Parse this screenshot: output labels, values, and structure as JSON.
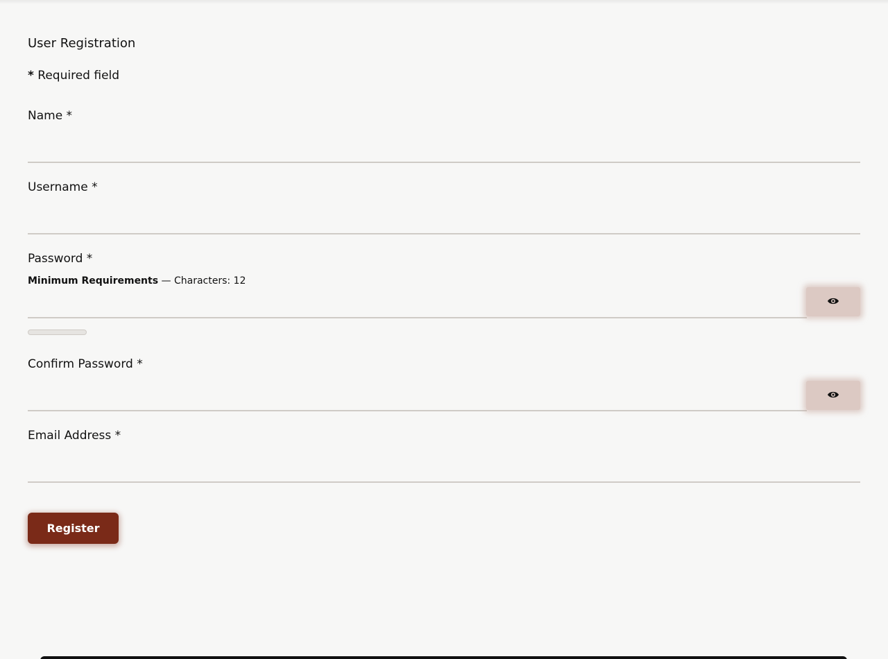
{
  "form": {
    "title": "User Registration",
    "required_star": "*",
    "required_text": "Required field",
    "fields": {
      "name": {
        "label": "Name *",
        "value": ""
      },
      "username": {
        "label": "Username *",
        "value": ""
      },
      "password": {
        "label": "Password *",
        "hint_bold": "Minimum Requirements",
        "hint_text": " — Characters: 12",
        "value": "",
        "strength": 0
      },
      "confirm_password": {
        "label": "Confirm Password *",
        "value": ""
      },
      "email": {
        "label": "Email Address *",
        "value": ""
      }
    },
    "register_label": "Register"
  },
  "icons": {
    "password_toggle": "eye-icon",
    "confirm_password_toggle": "eye-icon"
  },
  "colors": {
    "background": "#f7f7f6",
    "primary_button": "#7a2a18",
    "toggle_button": "#dcc9c3",
    "input_border": "#cfcbc6"
  }
}
